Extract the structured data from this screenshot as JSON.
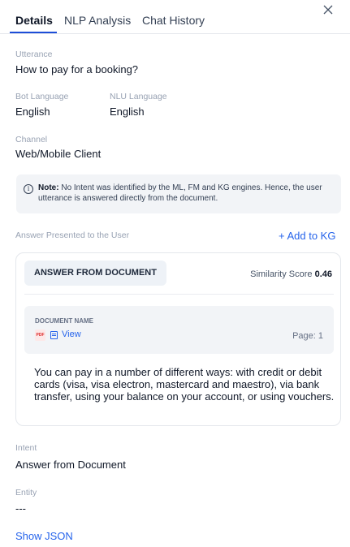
{
  "tabs": [
    {
      "label": "Details",
      "active": true
    },
    {
      "label": "NLP Analysis",
      "active": false
    },
    {
      "label": "Chat History",
      "active": false
    }
  ],
  "close_icon": "close-icon",
  "utterance": {
    "label": "Utterance",
    "value": "How to pay for a booking?"
  },
  "bot_language": {
    "label": "Bot Language",
    "value": "English"
  },
  "nlu_language": {
    "label": "NLU Language",
    "value": "English"
  },
  "channel": {
    "label": "Channel",
    "value": "Web/Mobile Client"
  },
  "note": {
    "icon": "info-icon",
    "prefix": "Note:",
    "text": "No Intent was identified by the ML, FM and KG engines. Hence, the user utterance is answered directly from the document."
  },
  "answer_section": {
    "label": "Answer Presented to the User",
    "add_kg": "+ Add to KG"
  },
  "answer_card": {
    "badge": "ANSWER FROM DOCUMENT",
    "similarity_label": "Similarity Score",
    "similarity_value": "0.46",
    "document_label": "DOCUMENT NAME",
    "pdf_icon_text": "PDF",
    "view_label": "View",
    "page": "Page: 1",
    "answer": "You can pay in a number of different ways: with credit or debit cards (visa, visa electron, mastercard and maestro), via bank transfer, using your balance on your account, or using vouchers."
  },
  "intent": {
    "label": "Intent",
    "value": "Answer from Document"
  },
  "entity": {
    "label": "Entity",
    "value": "---"
  },
  "show_json": "Show JSON",
  "colors": {
    "accent": "#2563eb",
    "text": "#101828",
    "muted": "#98a2b3",
    "panel": "#f2f4f7"
  }
}
